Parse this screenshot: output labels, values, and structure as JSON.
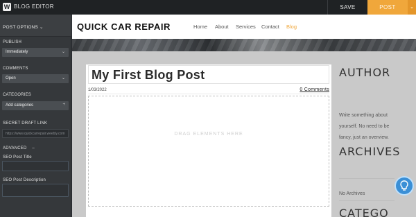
{
  "app": {
    "title": "BLOG EDITOR",
    "save_label": "SAVE",
    "post_label": "POST",
    "post_caret": "⌄",
    "logo_glyph": "W",
    "accent_color": "#f0a73b"
  },
  "sidebar": {
    "header": "POST OPTIONS ⌄",
    "publish_label": "PUBLISH",
    "publish_value": "Immediately",
    "comments_label": "COMMENTS",
    "comments_value": "Open",
    "categories_label": "CATEGORIES",
    "categories_value": "Add categories",
    "categories_add": "+",
    "secret_label": "SECRET DRAFT LINK",
    "secret_value": "https://www.quickcarrepair.weebly.com",
    "advanced_label": "ADVANCED",
    "advanced_toggle": "–",
    "seo_title_label": "SEO Post Title",
    "seo_title_value": "",
    "seo_desc_label": "SEO Post Description",
    "seo_desc_value": "",
    "dropdown_arrow": "⌄"
  },
  "site": {
    "brand": "QUICK CAR REPAIR",
    "nav": [
      "Home",
      "About",
      "Services",
      "Contact",
      "Blog"
    ],
    "active_nav": "Blog"
  },
  "post": {
    "title": "My First Blog Post",
    "date": "1/03/2022",
    "comments": "0 Comments",
    "dropzone": "DRAG ELEMENTS HERE"
  },
  "aside": {
    "author_heading": "AUTHOR",
    "author_text": "Write something about yourself. No need to be fancy, just an overview.",
    "archives_heading": "ARCHIVES",
    "archives_text": "No Archives",
    "categories_heading": "CATEGO"
  }
}
